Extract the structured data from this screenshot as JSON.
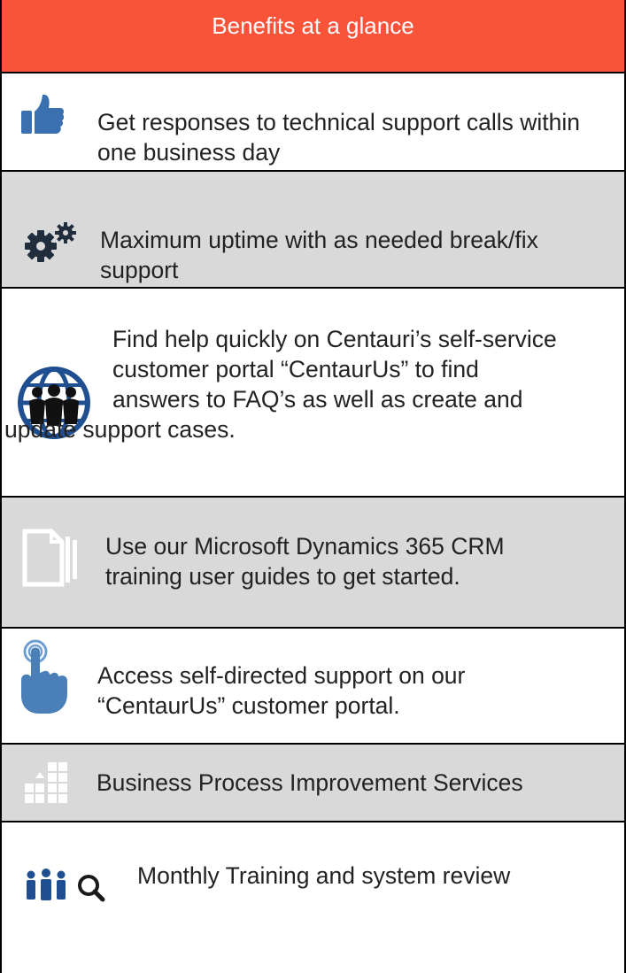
{
  "header": {
    "title": "Benefits at a glance"
  },
  "benefits": [
    {
      "icon": "thumbs-up-icon",
      "line1": "Get responses to technical support calls within",
      "line2": "one business day"
    },
    {
      "icon": "gears-icon",
      "line1": "Maximum uptime with as needed break/fix",
      "line2": "support"
    },
    {
      "icon": "globe-people-icon",
      "line1": "Find help quickly on Centauri’s self-service",
      "line2": "customer portal “CentaurUs” to find",
      "line3": "answers to FAQ’s as well as create and",
      "line4": "update support cases."
    },
    {
      "icon": "documents-icon",
      "line1": "Use our Microsoft Dynamics 365 CRM",
      "line2": "training user guides to get started."
    },
    {
      "icon": "touch-hand-icon",
      "line1": "Access self-directed support on our",
      "line2": "“CentaurUs” customer portal."
    },
    {
      "icon": "growth-blocks-icon",
      "line1": "Business Process Improvement Services"
    },
    {
      "icon": "people-search-icon",
      "line1": "Monthly Training and system review"
    }
  ],
  "colors": {
    "header_bg": "#f9533a",
    "grey_row": "#d9d9d9",
    "icon_blue": "#3a6fb0"
  }
}
